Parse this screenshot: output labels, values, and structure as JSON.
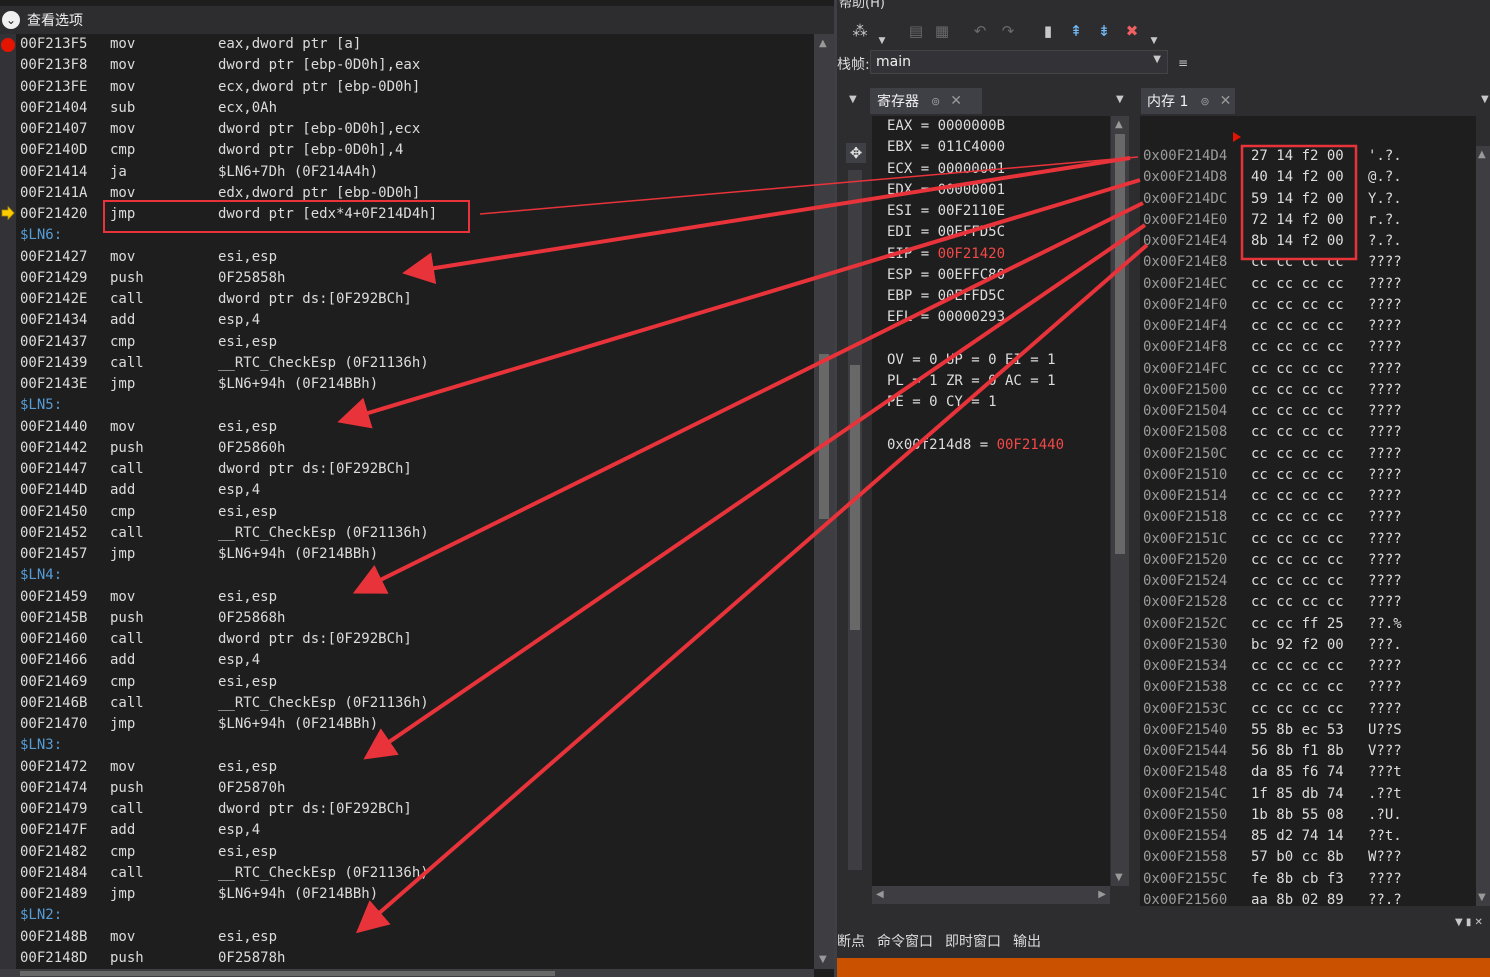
{
  "disassembly": {
    "header": "查看选项",
    "lines": [
      {
        "addr": "00F213F5",
        "mn": "mov",
        "op": "eax,dword ptr [a]"
      },
      {
        "addr": "00F213F8",
        "mn": "mov",
        "op": "dword ptr [ebp-0D0h],eax"
      },
      {
        "addr": "00F213FE",
        "mn": "mov",
        "op": "ecx,dword ptr [ebp-0D0h]"
      },
      {
        "addr": "00F21404",
        "mn": "sub",
        "op": "ecx,0Ah"
      },
      {
        "addr": "00F21407",
        "mn": "mov",
        "op": "dword ptr [ebp-0D0h],ecx"
      },
      {
        "addr": "00F2140D",
        "mn": "cmp",
        "op": "dword ptr [ebp-0D0h],4"
      },
      {
        "addr": "00F21414",
        "mn": "ja",
        "op": "$LN6+7Dh (0F214A4h)"
      },
      {
        "addr": "00F2141A",
        "mn": "mov",
        "op": "edx,dword ptr [ebp-0D0h]"
      },
      {
        "addr": "00F21420",
        "mn": "jmp",
        "op": "dword ptr [edx*4+0F214D4h]"
      },
      {
        "label": "$LN6:"
      },
      {
        "addr": "00F21427",
        "mn": "mov",
        "op": "esi,esp"
      },
      {
        "addr": "00F21429",
        "mn": "push",
        "op": "0F25858h"
      },
      {
        "addr": "00F2142E",
        "mn": "call",
        "op": "dword ptr ds:[0F292BCh]"
      },
      {
        "addr": "00F21434",
        "mn": "add",
        "op": "esp,4"
      },
      {
        "addr": "00F21437",
        "mn": "cmp",
        "op": "esi,esp"
      },
      {
        "addr": "00F21439",
        "mn": "call",
        "op": "__RTC_CheckEsp (0F21136h)"
      },
      {
        "addr": "00F2143E",
        "mn": "jmp",
        "op": "$LN6+94h (0F214BBh)"
      },
      {
        "label": "$LN5:"
      },
      {
        "addr": "00F21440",
        "mn": "mov",
        "op": "esi,esp"
      },
      {
        "addr": "00F21442",
        "mn": "push",
        "op": "0F25860h"
      },
      {
        "addr": "00F21447",
        "mn": "call",
        "op": "dword ptr ds:[0F292BCh]"
      },
      {
        "addr": "00F2144D",
        "mn": "add",
        "op": "esp,4"
      },
      {
        "addr": "00F21450",
        "mn": "cmp",
        "op": "esi,esp"
      },
      {
        "addr": "00F21452",
        "mn": "call",
        "op": "__RTC_CheckEsp (0F21136h)"
      },
      {
        "addr": "00F21457",
        "mn": "jmp",
        "op": "$LN6+94h (0F214BBh)"
      },
      {
        "label": "$LN4:"
      },
      {
        "addr": "00F21459",
        "mn": "mov",
        "op": "esi,esp"
      },
      {
        "addr": "00F2145B",
        "mn": "push",
        "op": "0F25868h"
      },
      {
        "addr": "00F21460",
        "mn": "call",
        "op": "dword ptr ds:[0F292BCh]"
      },
      {
        "addr": "00F21466",
        "mn": "add",
        "op": "esp,4"
      },
      {
        "addr": "00F21469",
        "mn": "cmp",
        "op": "esi,esp"
      },
      {
        "addr": "00F2146B",
        "mn": "call",
        "op": "__RTC_CheckEsp (0F21136h)"
      },
      {
        "addr": "00F21470",
        "mn": "jmp",
        "op": "$LN6+94h (0F214BBh)"
      },
      {
        "label": "$LN3:"
      },
      {
        "addr": "00F21472",
        "mn": "mov",
        "op": "esi,esp"
      },
      {
        "addr": "00F21474",
        "mn": "push",
        "op": "0F25870h"
      },
      {
        "addr": "00F21479",
        "mn": "call",
        "op": "dword ptr ds:[0F292BCh]"
      },
      {
        "addr": "00F2147F",
        "mn": "add",
        "op": "esp,4"
      },
      {
        "addr": "00F21482",
        "mn": "cmp",
        "op": "esi,esp"
      },
      {
        "addr": "00F21484",
        "mn": "call",
        "op": "__RTC_CheckEsp (0F21136h)"
      },
      {
        "addr": "00F21489",
        "mn": "jmp",
        "op": "$LN6+94h (0F214BBh)"
      },
      {
        "label": "$LN2:"
      },
      {
        "addr": "00F2148B",
        "mn": "mov",
        "op": "esi,esp"
      },
      {
        "addr": "00F2148D",
        "mn": "push",
        "op": "0F25878h"
      }
    ]
  },
  "menu": {
    "help": "帮助(H)"
  },
  "stack_frame": {
    "label": "栈帧:",
    "value": "main"
  },
  "registers": {
    "tab_label": "寄存器",
    "lines": [
      {
        "text": "EAX = 0000000B"
      },
      {
        "text": "EBX = 011C4000"
      },
      {
        "text": "ECX = 00000001"
      },
      {
        "text": "EDX = 00000001"
      },
      {
        "text": "ESI = 00F2110E"
      },
      {
        "text": "EDI = 00EFFD5C"
      },
      {
        "prefix": "EIP = ",
        "changed": "00F21420"
      },
      {
        "text": "ESP = 00EFFC80"
      },
      {
        "text": "EBP = 00EFFD5C"
      },
      {
        "text": "EFL = 00000293"
      },
      {
        "text": ""
      },
      {
        "text": "OV = 0 UP = 0 EI = 1"
      },
      {
        "text": "PL = 1 ZR = 0 AC = 1"
      },
      {
        "text": "PE = 0 CY = 1"
      },
      {
        "text": ""
      },
      {
        "prefix": "0x00f214d8 = ",
        "changed": "00F21440"
      }
    ]
  },
  "memory": {
    "tab_label": "内存 1",
    "rows": [
      {
        "addr": "0x00F214D4",
        "bytes": "27 14 f2 00",
        "ascii": "'.?."
      },
      {
        "addr": "0x00F214D8",
        "bytes": "40 14 f2 00",
        "ascii": "@.?."
      },
      {
        "addr": "0x00F214DC",
        "bytes": "59 14 f2 00",
        "ascii": "Y.?."
      },
      {
        "addr": "0x00F214E0",
        "bytes": "72 14 f2 00",
        "ascii": "r.?."
      },
      {
        "addr": "0x00F214E4",
        "bytes": "8b 14 f2 00",
        "ascii": "?.?."
      },
      {
        "addr": "0x00F214E8",
        "bytes": "cc cc cc cc",
        "ascii": "????"
      },
      {
        "addr": "0x00F214EC",
        "bytes": "cc cc cc cc",
        "ascii": "????"
      },
      {
        "addr": "0x00F214F0",
        "bytes": "cc cc cc cc",
        "ascii": "????"
      },
      {
        "addr": "0x00F214F4",
        "bytes": "cc cc cc cc",
        "ascii": "????"
      },
      {
        "addr": "0x00F214F8",
        "bytes": "cc cc cc cc",
        "ascii": "????"
      },
      {
        "addr": "0x00F214FC",
        "bytes": "cc cc cc cc",
        "ascii": "????"
      },
      {
        "addr": "0x00F21500",
        "bytes": "cc cc cc cc",
        "ascii": "????"
      },
      {
        "addr": "0x00F21504",
        "bytes": "cc cc cc cc",
        "ascii": "????"
      },
      {
        "addr": "0x00F21508",
        "bytes": "cc cc cc cc",
        "ascii": "????"
      },
      {
        "addr": "0x00F2150C",
        "bytes": "cc cc cc cc",
        "ascii": "????"
      },
      {
        "addr": "0x00F21510",
        "bytes": "cc cc cc cc",
        "ascii": "????"
      },
      {
        "addr": "0x00F21514",
        "bytes": "cc cc cc cc",
        "ascii": "????"
      },
      {
        "addr": "0x00F21518",
        "bytes": "cc cc cc cc",
        "ascii": "????"
      },
      {
        "addr": "0x00F2151C",
        "bytes": "cc cc cc cc",
        "ascii": "????"
      },
      {
        "addr": "0x00F21520",
        "bytes": "cc cc cc cc",
        "ascii": "????"
      },
      {
        "addr": "0x00F21524",
        "bytes": "cc cc cc cc",
        "ascii": "????"
      },
      {
        "addr": "0x00F21528",
        "bytes": "cc cc cc cc",
        "ascii": "????"
      },
      {
        "addr": "0x00F2152C",
        "bytes": "cc cc ff 25",
        "ascii": "??.%"
      },
      {
        "addr": "0x00F21530",
        "bytes": "bc 92 f2 00",
        "ascii": "???."
      },
      {
        "addr": "0x00F21534",
        "bytes": "cc cc cc cc",
        "ascii": "????"
      },
      {
        "addr": "0x00F21538",
        "bytes": "cc cc cc cc",
        "ascii": "????"
      },
      {
        "addr": "0x00F2153C",
        "bytes": "cc cc cc cc",
        "ascii": "????"
      },
      {
        "addr": "0x00F21540",
        "bytes": "55 8b ec 53",
        "ascii": "U??S"
      },
      {
        "addr": "0x00F21544",
        "bytes": "56 8b f1 8b",
        "ascii": "V???"
      },
      {
        "addr": "0x00F21548",
        "bytes": "da 85 f6 74",
        "ascii": "???t"
      },
      {
        "addr": "0x00F2154C",
        "bytes": "1f 85 db 74",
        "ascii": ".??t"
      },
      {
        "addr": "0x00F21550",
        "bytes": "1b 8b 55 08",
        "ascii": ".?U."
      },
      {
        "addr": "0x00F21554",
        "bytes": "85 d2 74 14",
        "ascii": "??t."
      },
      {
        "addr": "0x00F21558",
        "bytes": "57 b0 cc 8b",
        "ascii": "W???"
      },
      {
        "addr": "0x00F2155C",
        "bytes": "fe 8b cb f3",
        "ascii": "????"
      },
      {
        "addr": "0x00F21560",
        "bytes": "aa 8b 02 89",
        "ascii": "??.?"
      }
    ]
  },
  "bottom_tabs": [
    "断点",
    "命令窗口",
    "即时窗口",
    "输出"
  ],
  "colors": {
    "annotation": "#e8333a",
    "status_bar": "#ca5100",
    "changed_value": "#f44747",
    "label": "#569cd6"
  }
}
